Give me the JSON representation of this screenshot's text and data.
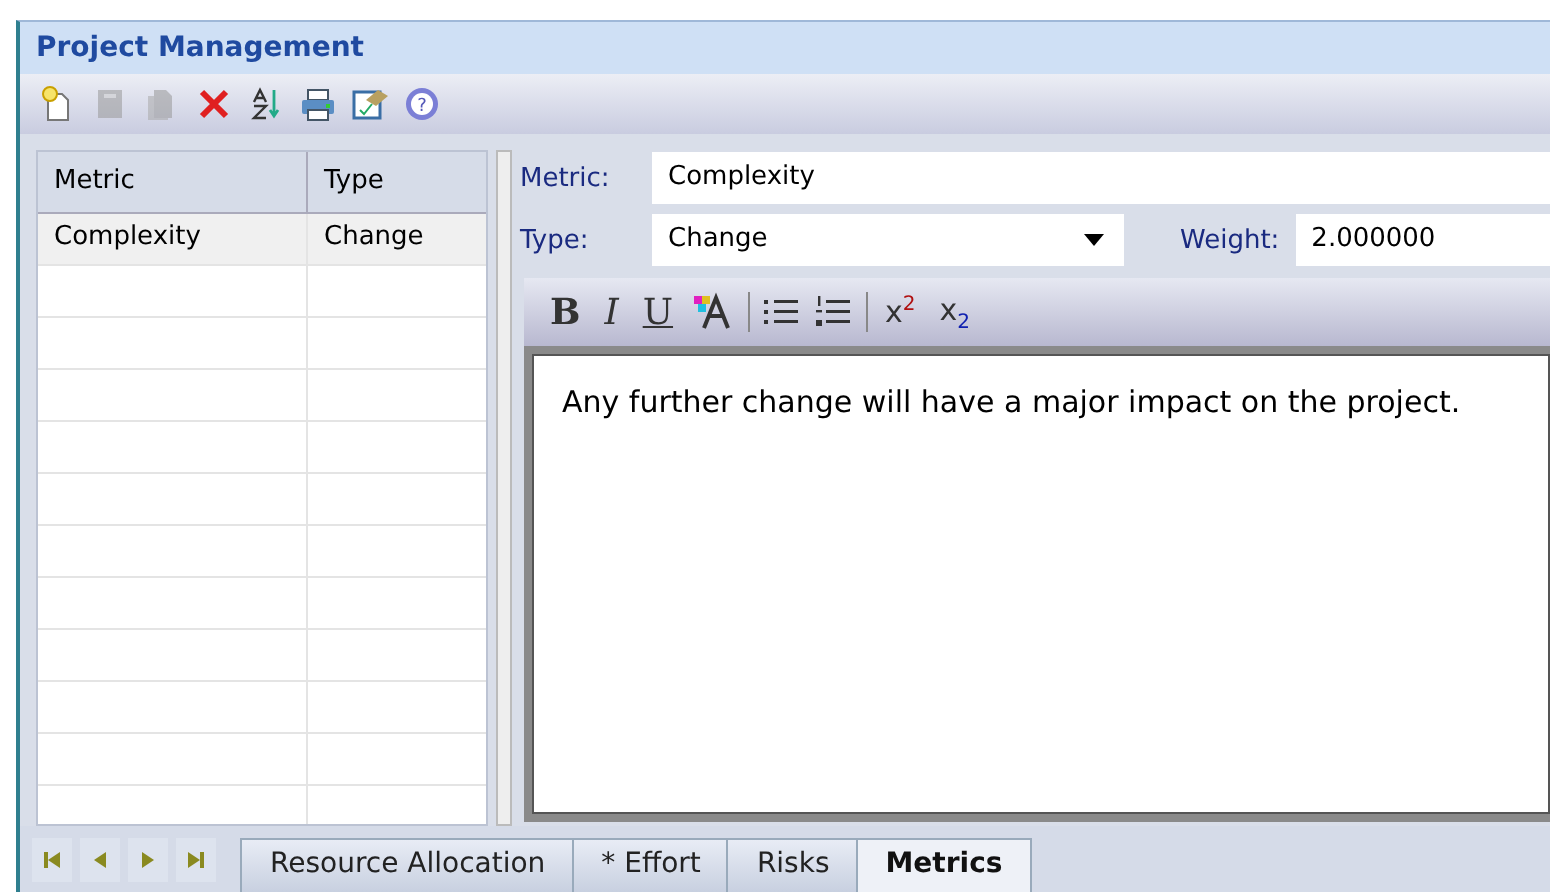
{
  "window": {
    "title": "Project Management"
  },
  "toolbar": [
    {
      "kind": "new",
      "disabled": false
    },
    {
      "kind": "save",
      "disabled": true
    },
    {
      "kind": "copy",
      "disabled": true
    },
    {
      "kind": "delete",
      "disabled": false
    },
    {
      "kind": "sort",
      "disabled": false
    },
    {
      "kind": "print",
      "disabled": false
    },
    {
      "kind": "properties",
      "disabled": false
    },
    {
      "kind": "help",
      "disabled": false,
      "symbol": "?"
    }
  ],
  "grid": {
    "columns": [
      "Metric",
      "Type"
    ],
    "rows": [
      {
        "cells": [
          "Complexity",
          "Change"
        ],
        "selected": true
      }
    ]
  },
  "form": {
    "metric_label": "Metric:",
    "metric": "Complexity",
    "type_label": "Type:",
    "type": "Change",
    "weight_label": "Weight:",
    "weight": "2.000000"
  },
  "format_bar": [
    {
      "kind": "bold",
      "text": "B"
    },
    {
      "kind": "italic",
      "text": "I"
    },
    {
      "kind": "underline",
      "text": "U"
    },
    {
      "kind": "font-color"
    },
    {
      "kind": "sep"
    },
    {
      "kind": "bullets"
    },
    {
      "kind": "numbering"
    },
    {
      "kind": "sep"
    },
    {
      "kind": "superscript",
      "text": "x",
      "mark": "2"
    },
    {
      "kind": "subscript",
      "text": "x",
      "mark": "2"
    }
  ],
  "notes": "Any further change will have a major impact on the project.",
  "nav_buttons": [
    {
      "kind": "first"
    },
    {
      "kind": "prev"
    },
    {
      "kind": "next"
    },
    {
      "kind": "last"
    }
  ],
  "tabs": [
    {
      "label": "Resource Allocation",
      "selected": false
    },
    {
      "label": "* Effort",
      "selected": false
    },
    {
      "label": "Risks",
      "selected": false
    },
    {
      "label": "Metrics",
      "selected": true
    }
  ]
}
